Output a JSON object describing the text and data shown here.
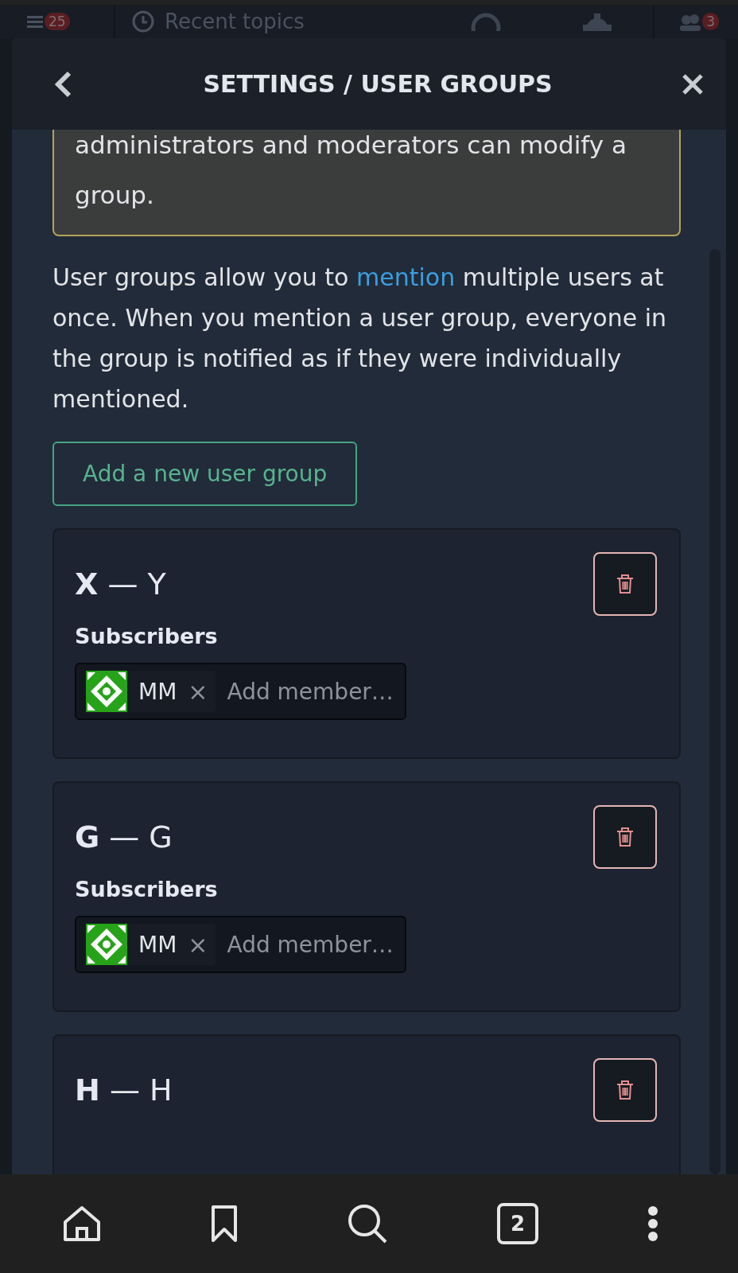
{
  "background_bar": {
    "unread_count": "25",
    "view_title": "Recent topics",
    "people_count": "3"
  },
  "modal": {
    "title": "SETTINGS / USER GROUPS",
    "warning_text": "administrators and moderators can modify a group.",
    "intro": {
      "before": "User groups allow you to ",
      "link": "mention",
      "after": " multiple users at once. When you mention a user group, everyone in the group is notified as if they were individually mentioned."
    },
    "add_button": "Add a new user group",
    "groups": [
      {
        "name": "**X** — Y",
        "subscribers_label": "Subscribers",
        "members": [
          {
            "name": "MM"
          }
        ],
        "remove_symbol": "×",
        "placeholder": "Add member…"
      },
      {
        "name": "**G** — G",
        "subscribers_label": "Subscribers",
        "members": [
          {
            "name": "MM"
          }
        ],
        "remove_symbol": "×",
        "placeholder": "Add member…"
      },
      {
        "name": "**H** — H"
      }
    ]
  },
  "bottom_nav": {
    "tab_count": "2"
  }
}
